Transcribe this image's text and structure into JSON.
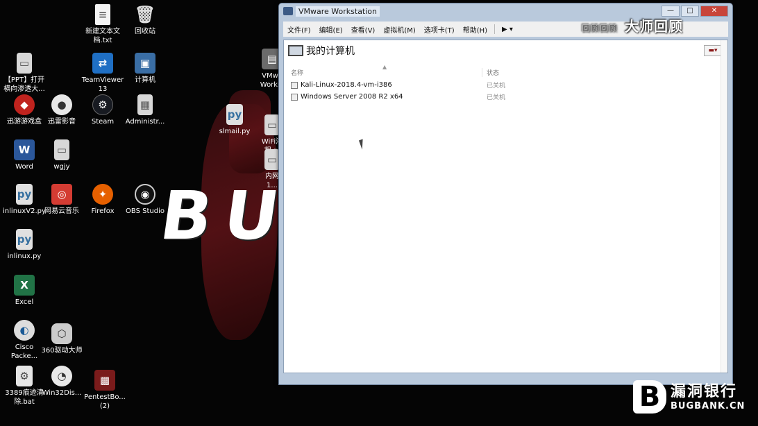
{
  "wallpaper": {
    "letters": "BU"
  },
  "desktop_icons": [
    {
      "label": "新建文本文\n档.txt",
      "glyph": "≡",
      "icon": "text-file-icon",
      "cls": "doc"
    },
    {
      "label": "回收站",
      "glyph": "🗑",
      "icon": "recycle-bin-icon",
      "cls": "bin"
    },
    {
      "label": "【PPT】打开\n横向渗透大...",
      "glyph": "▭",
      "icon": "shortcut-icon",
      "cls": "file"
    },
    {
      "label": "TeamViewer\n13",
      "glyph": "⇄",
      "icon": "teamviewer-icon",
      "cls": "blue"
    },
    {
      "label": "计算机",
      "glyph": "▣",
      "icon": "computer-icon",
      "cls": "pc"
    },
    {
      "label": "VMwa\nWorkst",
      "glyph": "▤",
      "icon": "vmware-icon",
      "cls": "vm"
    },
    {
      "label": "迅游游戏盒",
      "glyph": "◆",
      "icon": "game-box-icon",
      "cls": "red"
    },
    {
      "label": "迅雷影音",
      "glyph": "●",
      "icon": "media-player-icon",
      "cls": "round"
    },
    {
      "label": "Steam",
      "glyph": "⚙",
      "icon": "steam-icon",
      "cls": "steam"
    },
    {
      "label": "Administr...",
      "glyph": "▦",
      "icon": "user-folder-icon",
      "cls": "file"
    },
    {
      "label": "slmail.py",
      "glyph": "py",
      "icon": "python-file-icon",
      "cls": "py"
    },
    {
      "label": "WiFi渗\n程.pl",
      "glyph": "▭",
      "icon": "script-file-icon",
      "cls": "file"
    },
    {
      "label": "内网\n1...",
      "glyph": "▭",
      "icon": "shortcut-icon",
      "cls": "file"
    },
    {
      "label": "Word",
      "glyph": "W",
      "icon": "word-icon",
      "cls": "word"
    },
    {
      "label": "wgjy",
      "glyph": "▭",
      "icon": "file-icon",
      "cls": "file"
    },
    {
      "label": "inlinuxV2.py",
      "glyph": "py",
      "icon": "python-file-icon",
      "cls": "py"
    },
    {
      "label": "网易云音乐",
      "glyph": "◎",
      "icon": "netease-music-icon",
      "cls": "netease"
    },
    {
      "label": "Firefox",
      "glyph": "✦",
      "icon": "firefox-icon",
      "cls": "firefox"
    },
    {
      "label": "OBS Studio",
      "glyph": "◉",
      "icon": "obs-icon",
      "cls": "obs"
    },
    {
      "label": "inlinux.py",
      "glyph": "py",
      "icon": "python-file-icon",
      "cls": "py"
    },
    {
      "label": "Excel",
      "glyph": "X",
      "icon": "excel-icon",
      "cls": "excel"
    },
    {
      "label": "Cisco\nPacke...",
      "glyph": "◐",
      "icon": "cisco-icon",
      "cls": "cisco"
    },
    {
      "label": "360驱动大师",
      "glyph": "⬡",
      "icon": "driver-icon",
      "cls": "drv"
    },
    {
      "label": "3389痕迹清\n除.bat",
      "glyph": "⚙",
      "icon": "batch-file-icon",
      "cls": "bat"
    },
    {
      "label": "Win32Dis...",
      "glyph": "◔",
      "icon": "disk-imager-icon",
      "cls": "round"
    },
    {
      "label": "PentestBo...\n(2)",
      "glyph": "▩",
      "icon": "pentestbox-icon",
      "cls": "box"
    }
  ],
  "vmware": {
    "title": "VMware Workstation",
    "controls": {
      "minimize": "—",
      "maximize": "□",
      "close": "✕"
    },
    "menu": [
      "文件(F)",
      "编辑(E)",
      "查看(V)",
      "虚拟机(M)",
      "选项卡(T)",
      "帮助(H)"
    ],
    "menu_extra": "▶ ▾",
    "heading": "我的计算机",
    "view_button": "▬▾",
    "columns": {
      "name": "名称",
      "state": "状态",
      "sort": "▲"
    },
    "vms": [
      {
        "name": "Kali-Linux-2018.4-vm-i386",
        "state": "已关机"
      },
      {
        "name": "Windows Server 2008 R2 x64",
        "state": "已关机"
      }
    ]
  },
  "watermark": {
    "top_faint": "回顾回顾",
    "top": "大师回顾",
    "brand_glyph": "B",
    "brand_cn": "漏洞银行",
    "brand_en": "BUGBANK.CN"
  }
}
